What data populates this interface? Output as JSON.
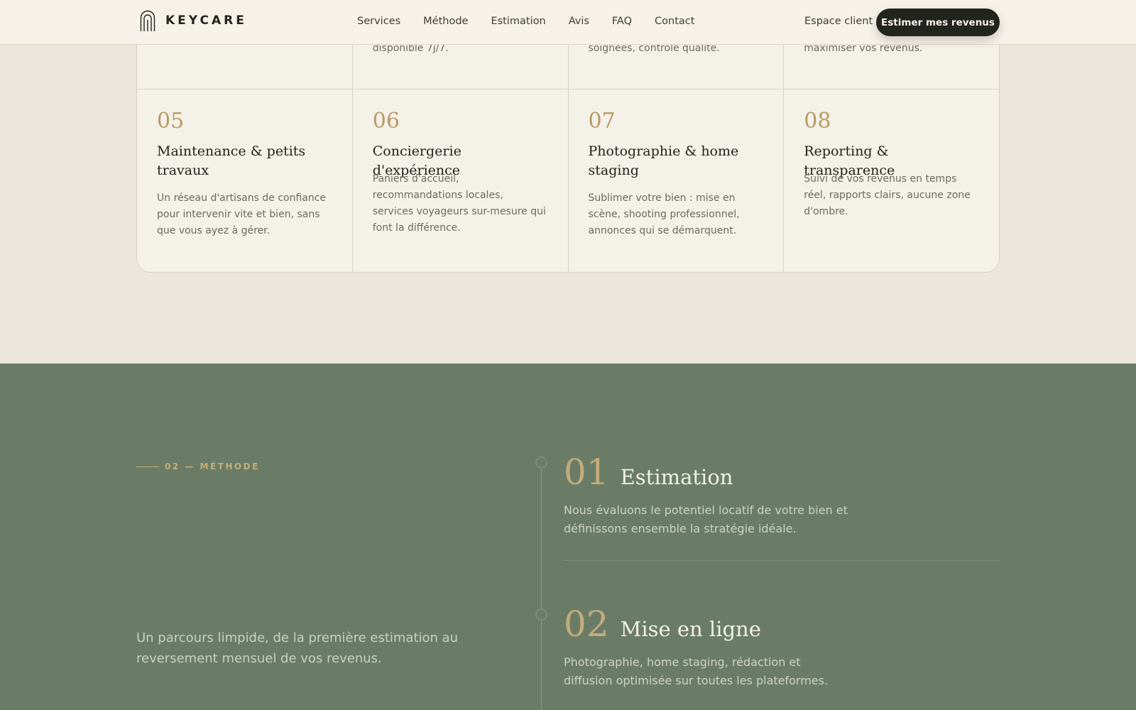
{
  "header": {
    "brand": "KEYCARE",
    "nav": [
      "Services",
      "Méthode",
      "Estimation",
      "Avis",
      "FAQ",
      "Contact"
    ],
    "client_link": "Espace client",
    "cta": "Estimer mes revenus"
  },
  "services": {
    "top_row_fragments": [
      "",
      "disponible 7j/7.",
      "soignées, contrôle qualité.",
      "maximiser vos revenus."
    ],
    "cards": [
      {
        "num": "05",
        "title": "Maintenance & petits travaux",
        "desc": "Un réseau d'artisans de confiance pour intervenir vite et bien, sans que vous ayez à gérer."
      },
      {
        "num": "06",
        "title": "Conciergerie d'expérience",
        "desc": "Paniers d'accueil, recommandations locales, services voyageurs sur-mesure qui font la différence."
      },
      {
        "num": "07",
        "title": "Photographie & home staging",
        "desc": "Sublimer votre bien : mise en scène, shooting professionnel, annonces qui se démarquent."
      },
      {
        "num": "08",
        "title": "Reporting & transparence",
        "desc": "Suivi de vos revenus en temps réel, rapports clairs, aucune zone d'ombre."
      }
    ]
  },
  "method": {
    "eyebrow": "02 — MÉTHODE",
    "intro": "Un parcours limpide, de la première estimation au reversement mensuel de vos revenus.",
    "steps": [
      {
        "num": "01",
        "title": "Estimation",
        "desc": "Nous évaluons le potentiel locatif de votre bien et définissons ensemble la stratégie idéale."
      },
      {
        "num": "02",
        "title": "Mise en ligne",
        "desc": "Photographie, home staging, rédaction et diffusion optimisée sur toutes les plateformes."
      }
    ]
  },
  "colors": {
    "accent_gold": "#b89a67",
    "dark": "#22241f",
    "sage": "#6a7c66",
    "cream": "#f6f2ea"
  }
}
